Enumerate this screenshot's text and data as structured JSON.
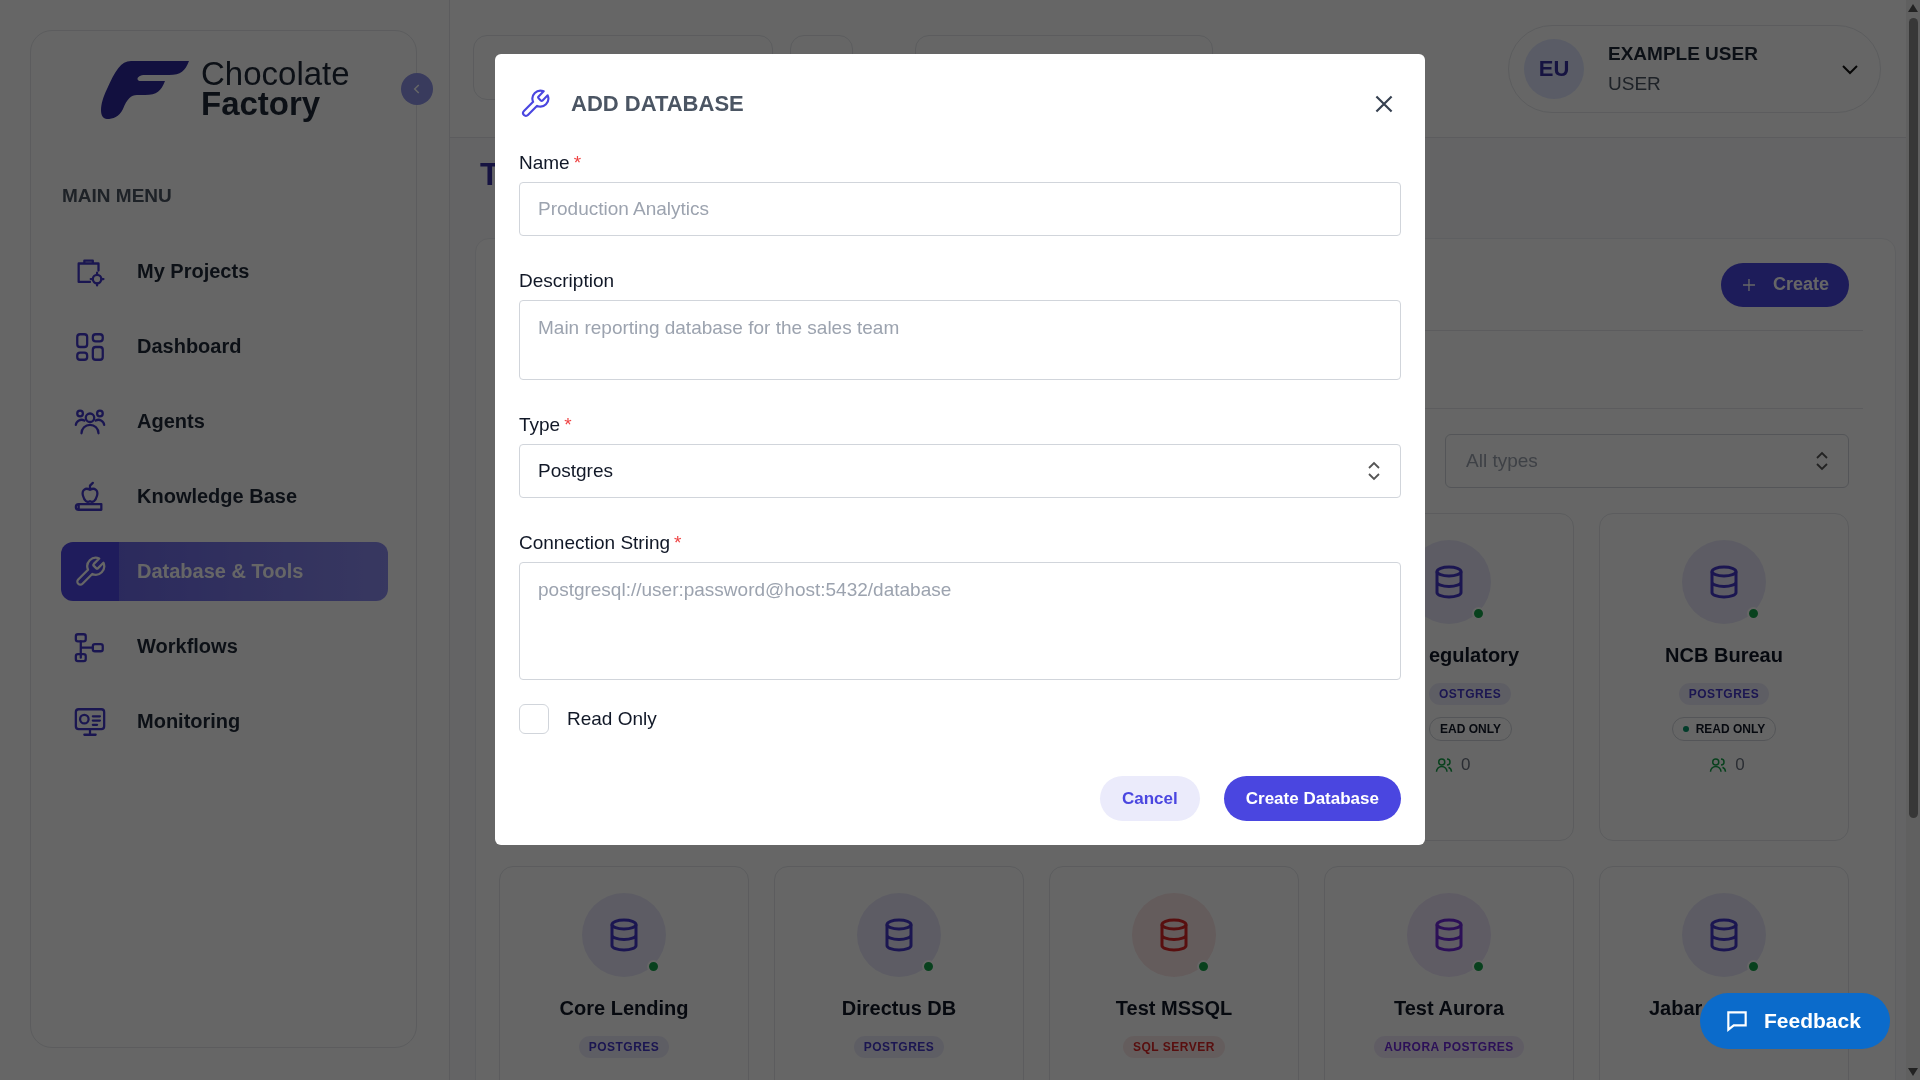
{
  "sidebar": {
    "logo": {
      "line1": "Chocolate",
      "line2": "Factory"
    },
    "section_title": "MAIN MENU",
    "items": [
      {
        "label": "My Projects",
        "selected": false
      },
      {
        "label": "Dashboard",
        "selected": false
      },
      {
        "label": "Agents",
        "selected": false
      },
      {
        "label": "Knowledge Base",
        "selected": false
      },
      {
        "label": "Database & Tools",
        "selected": true
      },
      {
        "label": "Workflows",
        "selected": false
      },
      {
        "label": "Monitoring",
        "selected": false
      }
    ]
  },
  "user": {
    "initials": "EU",
    "name": "EXAMPLE USER",
    "role": "USER"
  },
  "page_title": "T",
  "create_button": "Create",
  "type_filter": {
    "placeholder": "All types"
  },
  "card_rows": [
    [
      {
        "kind": "leftcut",
        "name": "egulatory",
        "type": "OSTGRES",
        "read_only": "EAD ONLY",
        "users": "0",
        "color": "#1b1651"
      },
      {
        "kind": "whole",
        "name": "NCB Bureau",
        "type": "POSTGRES",
        "read_only": "READ ONLY",
        "users": "0",
        "color": "#1b1651"
      }
    ],
    [
      {
        "kind": "whole",
        "name": "Core Lending",
        "type": "POSTGRES",
        "color": "#1b1651"
      },
      {
        "kind": "whole",
        "name": "Directus DB",
        "type": "POSTGRES",
        "color": "#1b1651"
      },
      {
        "kind": "whole",
        "name": "Test MSSQL",
        "type": "SQL SERVER",
        "color": "#580f0f"
      },
      {
        "kind": "whole",
        "name": "Test Aurora",
        "type": "AURORA POSTGRES",
        "color": "#2c1057"
      },
      {
        "kind": "rightcut",
        "name": "Jabar",
        "color": "#1b1651"
      }
    ]
  ],
  "feedback_button": "Feedback",
  "modal": {
    "title": "ADD DATABASE",
    "fields": [
      {
        "kind": "input",
        "label": "Name",
        "required_mark": "*",
        "placeholder": "Production Analytics"
      },
      {
        "kind": "textarea",
        "label": "Description",
        "placeholder": "Main reporting database for the sales team"
      },
      {
        "kind": "select",
        "label": "Type",
        "required_mark": "*",
        "value": "Postgres"
      },
      {
        "kind": "codearea",
        "label": "Connection String",
        "required_mark": "*",
        "placeholder": "postgresql://user:password@host:5432/database"
      }
    ],
    "checkbox": {
      "label": "Read Only",
      "checked": false
    },
    "cancel": "Cancel",
    "submit": "Create Database"
  }
}
